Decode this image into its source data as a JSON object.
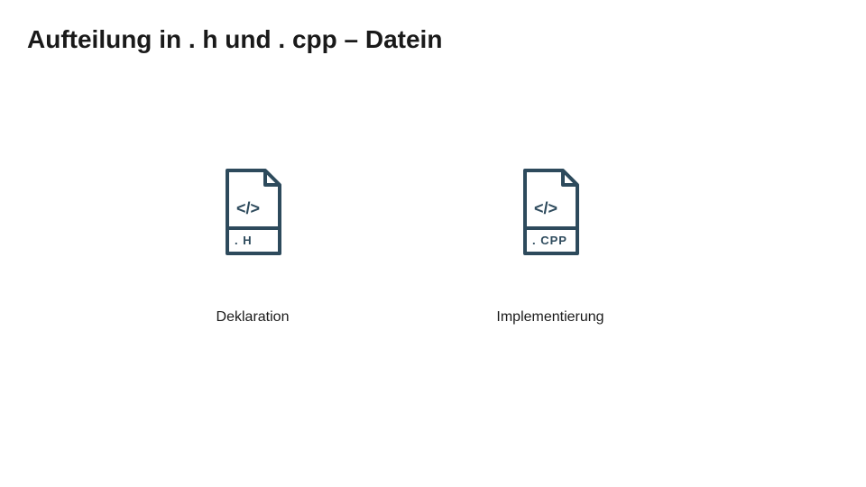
{
  "title": "Aufteilung in . h und . cpp – Datein",
  "files": [
    {
      "ext": ". H",
      "caption": "Deklaration"
    },
    {
      "ext": ". CPP",
      "caption": "Implementierung"
    }
  ],
  "iconColor": "#2d4a5c"
}
